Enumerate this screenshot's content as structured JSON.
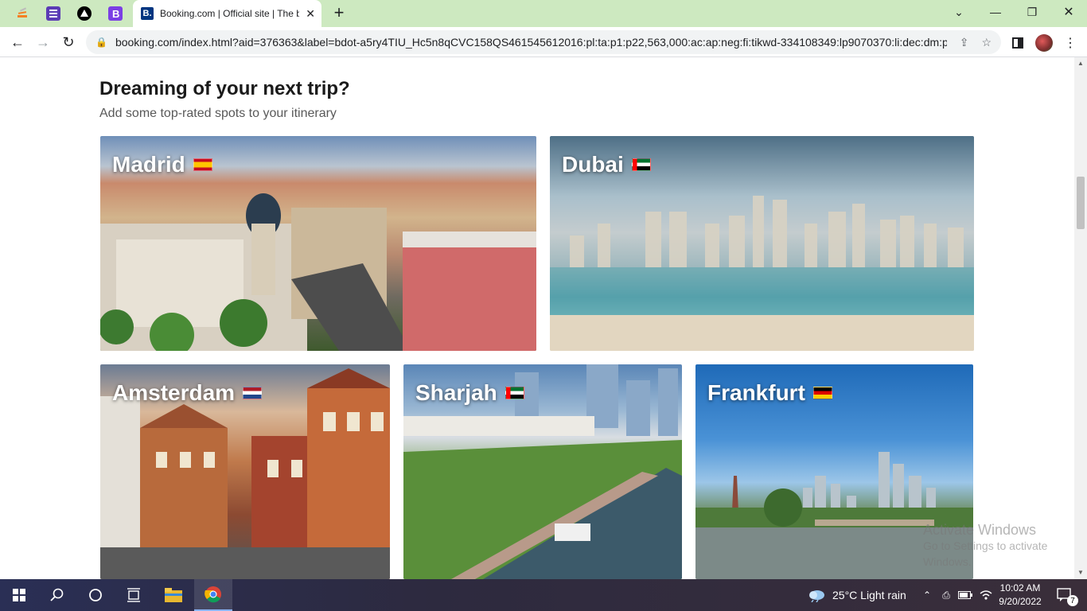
{
  "browser": {
    "tab_title": "Booking.com | Official site | The b",
    "tab_favicon": "B.",
    "url": "booking.com/index.html?aid=376363&label=bdot-a5ry4TIU_Hc5n8qCVC158QS461545612016:pl:ta:p1:p22,563,000:ac:ap:neg:fi:tikwd-334108349:lp9070370:li:dec:dm:pp...",
    "pinned_tabs": [
      "stack-icon",
      "list-icon",
      "triangle-icon",
      "b-icon"
    ]
  },
  "page": {
    "heading": "Dreaming of your next trip?",
    "subheading": "Add some top-rated spots to your itinerary",
    "destinations": [
      {
        "name": "Madrid",
        "flag": "flag-spain-icon"
      },
      {
        "name": "Dubai",
        "flag": "flag-uae-icon"
      },
      {
        "name": "Amsterdam",
        "flag": "flag-netherlands-icon"
      },
      {
        "name": "Sharjah",
        "flag": "flag-uae-icon"
      },
      {
        "name": "Frankfurt",
        "flag": "flag-germany-icon"
      }
    ]
  },
  "watermark": {
    "line1": "Activate Windows",
    "line2": "Go to Settings to activate Windows."
  },
  "taskbar": {
    "weather": "25°C  Light rain",
    "time": "10:02 AM",
    "date": "9/20/2022",
    "notifications": "7"
  },
  "colors": {
    "tabstrip": "#cde9c0",
    "booking_blue": "#003580",
    "taskbar": "#2a2f55"
  }
}
